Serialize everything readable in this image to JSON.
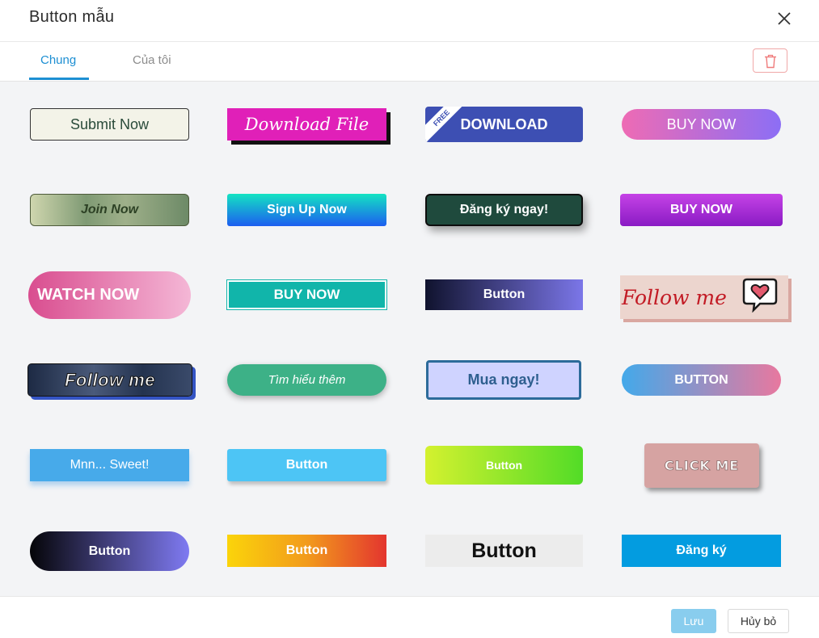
{
  "dialog": {
    "title": "Button mẫu"
  },
  "tabs": [
    {
      "label": "Chung"
    },
    {
      "label": "Của tôi"
    }
  ],
  "icons": {
    "close": "close-icon",
    "trash": "trash-icon",
    "heart_bubble": "heart-speech-bubble-icon"
  },
  "colors": {
    "accent": "#1d8fd3",
    "save_button": "#89cdee",
    "danger_border": "#f0a8a8"
  },
  "buttons": [
    {
      "label": "Submit Now"
    },
    {
      "label": "Download File"
    },
    {
      "label": "DOWNLOAD",
      "ribbon": "FREE"
    },
    {
      "label": "BUY NOW"
    },
    {
      "label": "Join Now"
    },
    {
      "label": "Sign Up Now"
    },
    {
      "label": "Đăng ký ngay!"
    },
    {
      "label": "BUY NOW"
    },
    {
      "label": "WATCH NOW"
    },
    {
      "label": "BUY NOW"
    },
    {
      "label": "Button"
    },
    {
      "label": "Follow me"
    },
    {
      "label": "Follow me"
    },
    {
      "label": "Tìm hiểu thêm"
    },
    {
      "label": "Mua ngay!"
    },
    {
      "label": "BUTTON"
    },
    {
      "label": "Mnn... Sweet!"
    },
    {
      "label": "Button"
    },
    {
      "label": "Button"
    },
    {
      "label": "CLICK ME"
    },
    {
      "label": "Button"
    },
    {
      "label": "Button"
    },
    {
      "label": "Button"
    },
    {
      "label": "Đăng ký"
    }
  ],
  "footer": {
    "save_label": "Lưu",
    "cancel_label": "Hủy bỏ"
  }
}
